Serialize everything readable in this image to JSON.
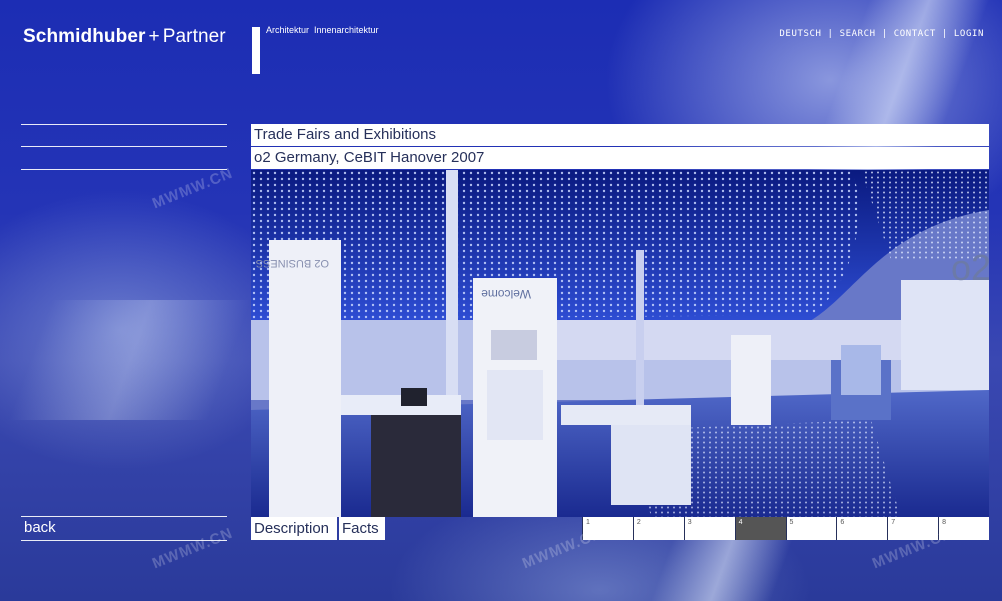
{
  "brand": {
    "name": "Schmidhuber",
    "plus": "+",
    "partner": "Partner",
    "tagline": [
      "Architektur",
      "Innenarchitektur"
    ]
  },
  "topnav": {
    "items": [
      "DEUTSCH",
      "SEARCH",
      "CONTACT",
      "LOGIN"
    ],
    "separator": "|"
  },
  "project": {
    "category": "Trade Fairs and Exhibitions",
    "title": "o2 Germany, CeBIT Hanover 2007"
  },
  "photo": {
    "sign_left": "O2 BUSINESS",
    "sign_center": "Welcome",
    "sign_right": "o2"
  },
  "sidebar": {
    "back_label": "back"
  },
  "tabs": {
    "description": "Description",
    "facts": "Facts"
  },
  "pager": {
    "pages": [
      "1",
      "2",
      "3",
      "4",
      "5",
      "6",
      "7",
      "8"
    ],
    "active_page": 4
  },
  "watermark": "MWMW.CN",
  "colors": {
    "background": "#2434b6",
    "band": "#ffffff",
    "band_text": "#26305a",
    "active_page": "#555555"
  }
}
